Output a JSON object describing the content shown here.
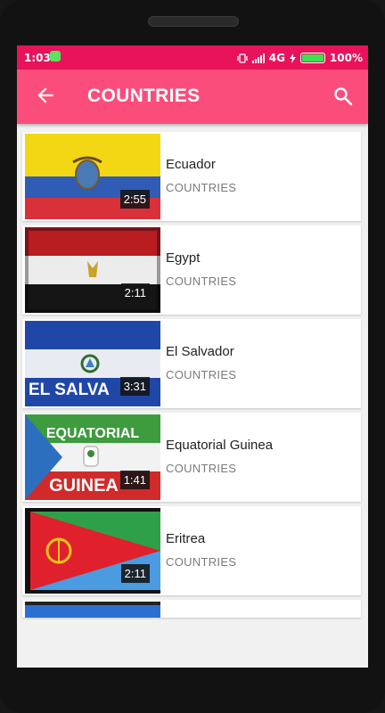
{
  "status_bar": {
    "time": "1:03",
    "network": "4G",
    "battery": "100%"
  },
  "app_bar": {
    "title": "COUNTRIES"
  },
  "videos": [
    {
      "title": "Ecuador",
      "channel": "COUNTRIES",
      "duration": "2:55"
    },
    {
      "title": "Egypt",
      "channel": "COUNTRIES",
      "duration": "2:11"
    },
    {
      "title": "El Salvador",
      "channel": "COUNTRIES",
      "duration": "3:31",
      "thumb_text": "EL SALVA"
    },
    {
      "title": "Equatorial Guinea",
      "channel": "COUNTRIES",
      "duration": "1:41",
      "thumb_text_top": "EQUATORIAL",
      "thumb_text_bottom": "GUINEA"
    },
    {
      "title": "Eritrea",
      "channel": "COUNTRIES",
      "duration": "2:11"
    }
  ]
}
